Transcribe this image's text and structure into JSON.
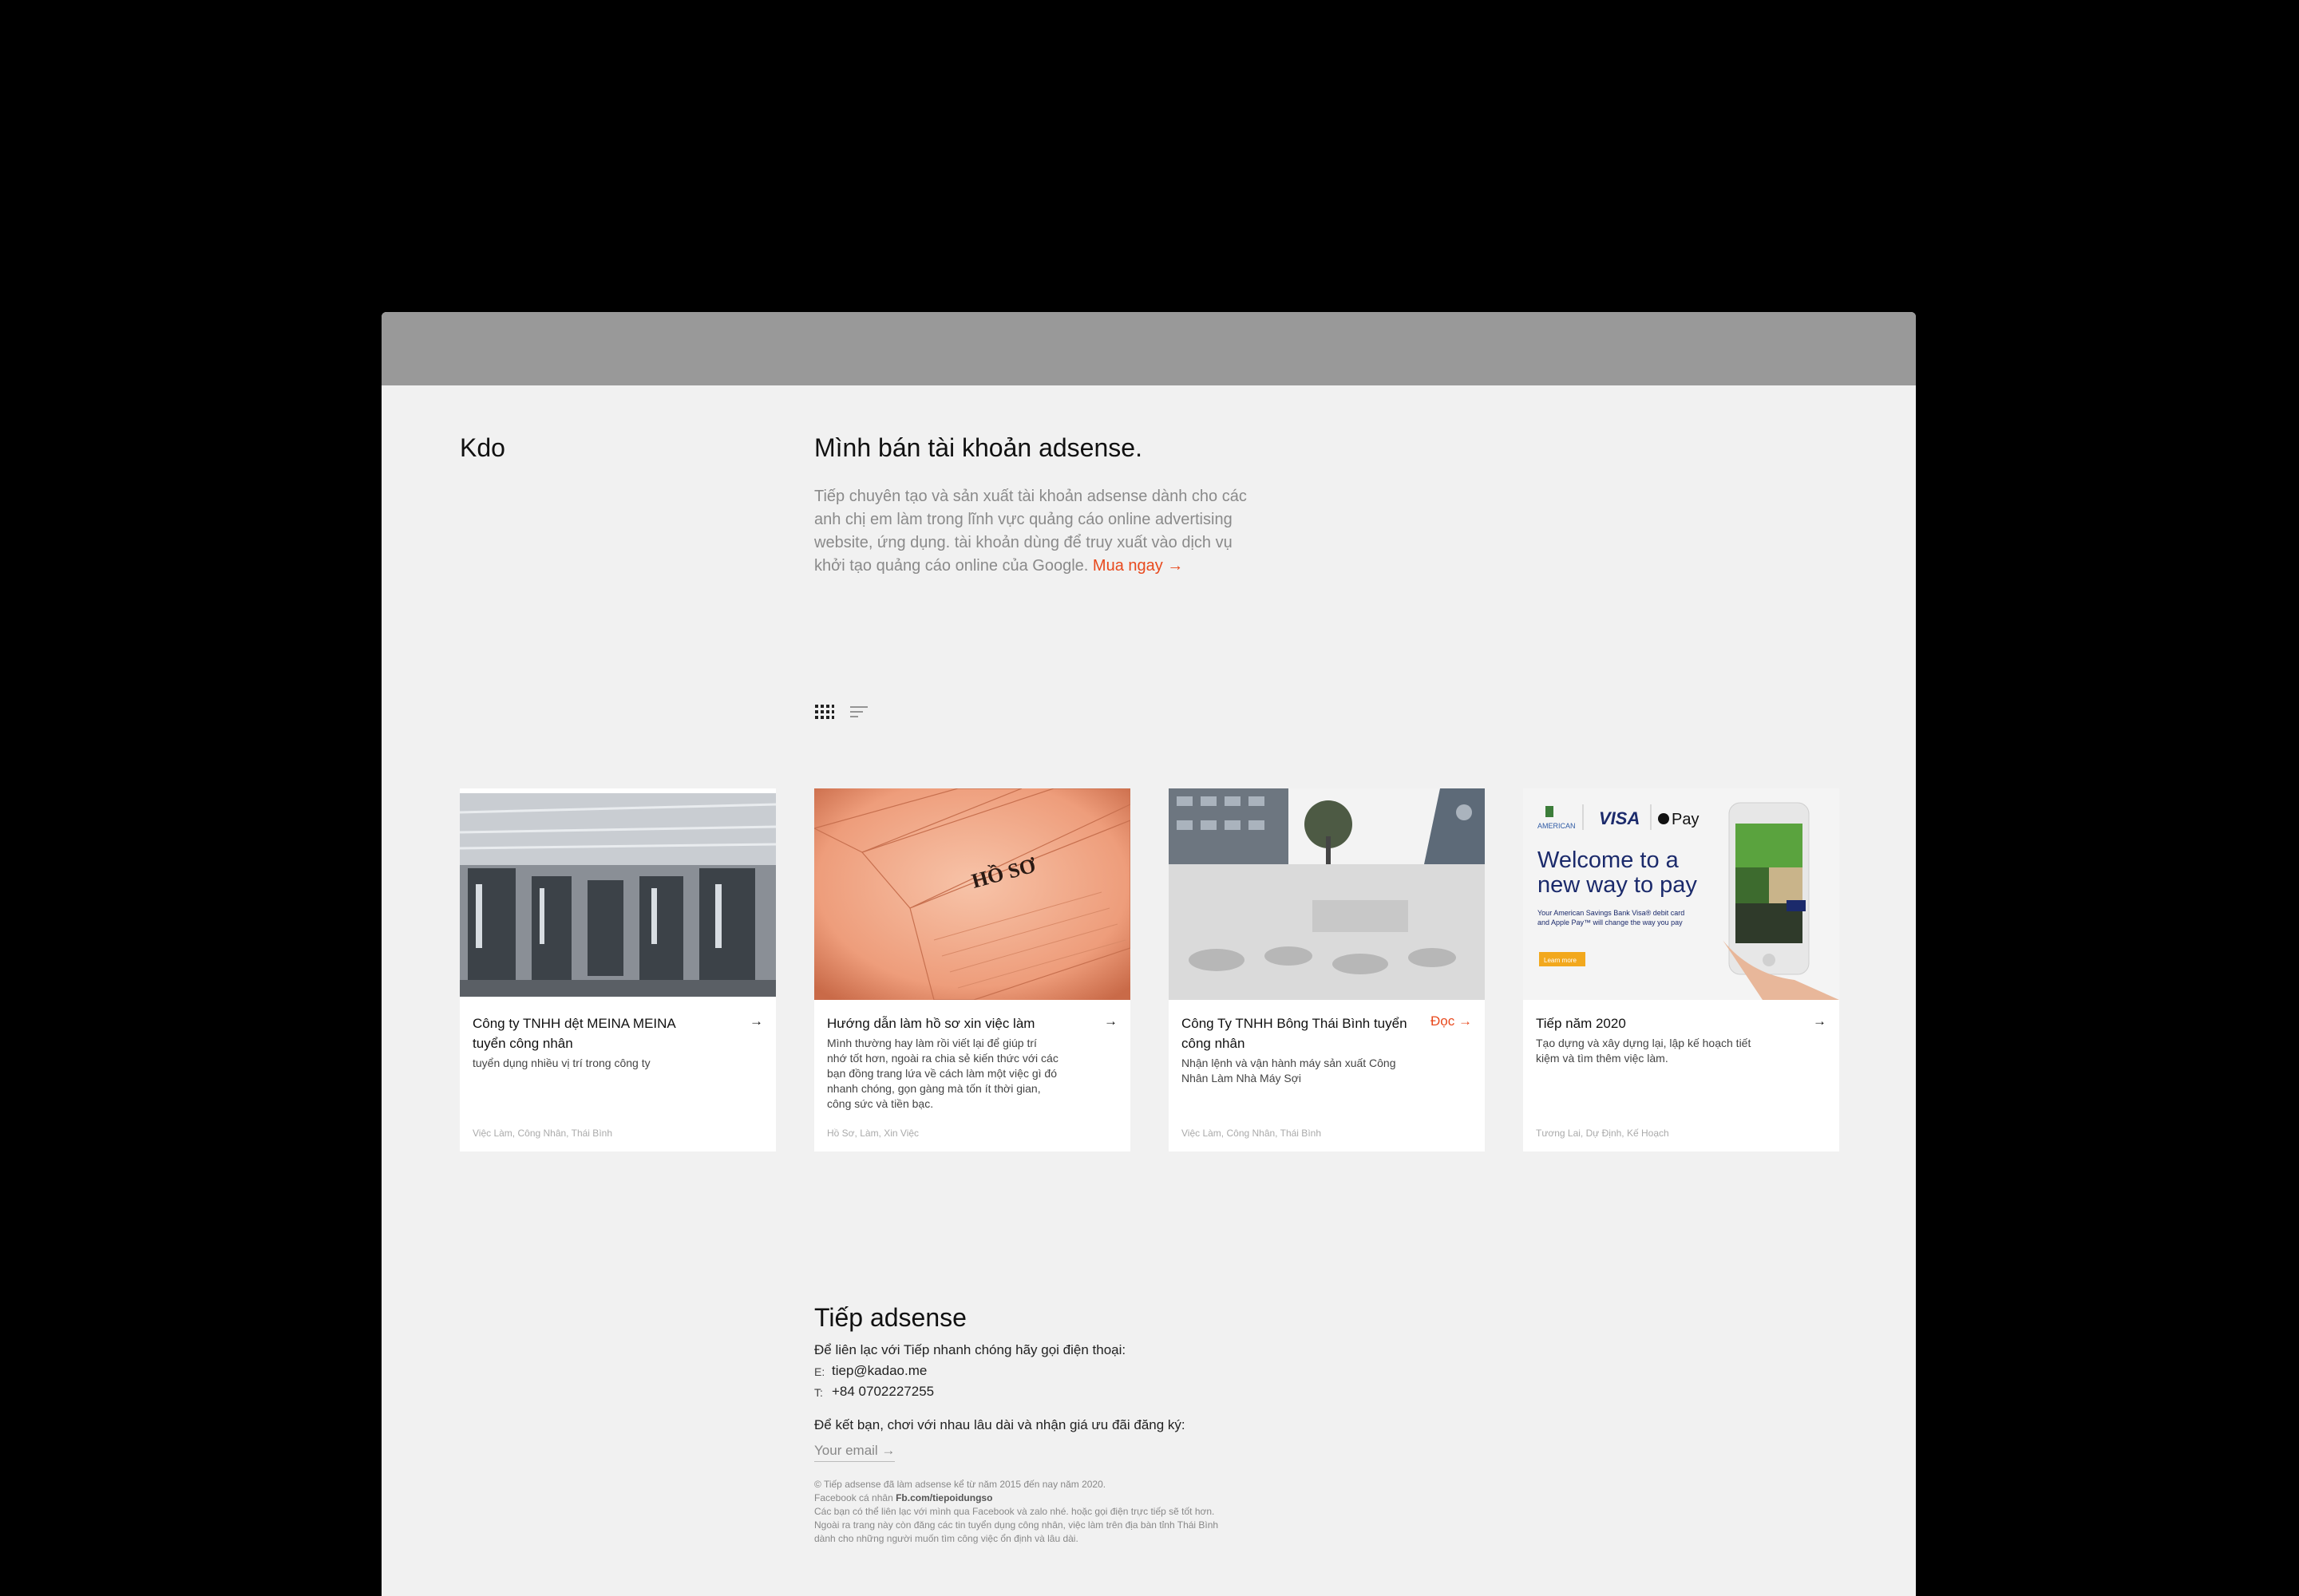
{
  "brand": {
    "logo": "Kdo"
  },
  "hero": {
    "title": "Mình bán tài khoản adsense.",
    "body": "Tiếp chuyên tạo và sản xuất tài khoản adsense dành cho các anh chị em làm trong lĩnh vực quảng cáo online advertising website, ứng dụng. tài khoản dùng để truy xuất vào dịch vụ khởi tạo quảng cáo online của Google.",
    "cta": "Mua ngay →"
  },
  "views": {
    "grid_icon": "grid-view-icon",
    "list_icon": "list-view-icon"
  },
  "cards": [
    {
      "title": "Công ty TNHH dệt MEINA MEINA tuyển công nhân",
      "arrow": "→",
      "desc": "tuyển dụng nhiều vị trí trong công ty",
      "tags": "Việc Làm, Công Nhân, Thái Bình"
    },
    {
      "title": "Hướng dẫn làm hồ sơ xin việc làm",
      "arrow": "→",
      "desc": "Mình thường hay làm rồi viết lại để giúp trí nhớ tốt hơn, ngoài ra chia sẻ kiến thức với các bạn đồng trang lứa về cách làm một việc gì đó nhanh chóng, gọn gàng mà tốn ít thời gian, công sức và tiền bạc.",
      "tags": "Hồ Sơ, Làm, Xin Việc",
      "img_text": "HỒ SƠ"
    },
    {
      "title": "Công Ty TNHH Bông Thái Bình tuyển công nhân",
      "arrow": "Đọc →",
      "desc": "Nhận lệnh và vận hành máy sản xuất Công Nhân Làm Nhà Máy Sợi",
      "tags": "Việc Làm, Công Nhân, Thái Bình"
    },
    {
      "title": "Tiếp năm 2020",
      "arrow": "→",
      "desc": "Tạo dựng và xây dựng lại, lập kế hoạch tiết kiệm và tìm thêm việc làm.",
      "tags": "Tương Lai, Dự Định, Kế Hoạch",
      "ad": {
        "brand": "AMERICAN",
        "visa": "VISA",
        "pay": "Pay",
        "headline": "Welcome to a new way to pay",
        "sub": "Your American Savings Bank Visa® debit card and Apple Pay™ will change the way you pay",
        "button": "Learn more"
      }
    }
  ],
  "contact": {
    "title": "Tiếp adsense",
    "intro": "Để liên lạc với Tiếp nhanh chóng hãy gọi điện thoại:",
    "email_key": "E:",
    "email": "tiep@kadao.me",
    "phone_key": "T:",
    "phone": "+84 0702227255",
    "subscribe": "Để kết bạn, chơi với nhau lâu dài và nhận giá ưu đãi đăng ký:",
    "email_placeholder": "Your email →"
  },
  "footer": {
    "line1": "© Tiếp adsense đã làm adsense kể từ năm 2015 đến nay năm 2020.",
    "fb_label": "Facebook cá nhân",
    "fb_link": "Fb.com/tiepoidungso",
    "line3": "Các bạn có thể liên lạc với mình qua Facebook và zalo nhé. hoặc gọi điện trực tiếp sẽ tốt hơn.",
    "line4": "Ngoài ra trang này còn đăng các tin tuyển dụng công nhân, việc làm trên địa bàn tỉnh Thái Bình",
    "line5": "dành cho những người muốn tìm công việc ổn định và lâu dài."
  }
}
